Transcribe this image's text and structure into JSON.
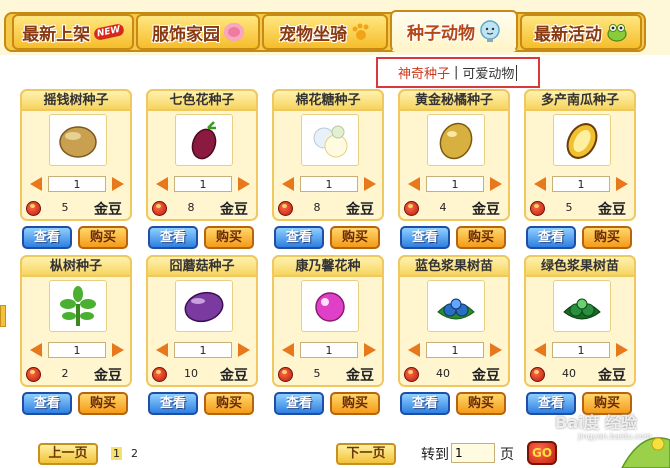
{
  "tabs": [
    {
      "label": "最新上架",
      "badge": "NEW",
      "icon": "new-badge-icon"
    },
    {
      "label": "服饰家园",
      "icon": "flower-icon"
    },
    {
      "label": "宠物坐骑",
      "icon": "paw-icon"
    },
    {
      "label": "种子动物",
      "icon": "lightbulb-icon",
      "active": true
    },
    {
      "label": "最新活动",
      "icon": "frog-icon"
    }
  ],
  "subcategory": {
    "items": [
      {
        "label": "神奇种子",
        "active": true
      },
      {
        "label": "可爱动物",
        "active": false
      }
    ],
    "separator": "|"
  },
  "items": [
    {
      "name": "摇钱树种子",
      "qty": "1",
      "price": "5",
      "currency": "金豆",
      "icon": "money-tree-seed-icon",
      "color": "#c8a050"
    },
    {
      "name": "七色花种子",
      "qty": "1",
      "price": "8",
      "currency": "金豆",
      "icon": "rainbow-flower-seed-icon",
      "color": "#8a1a40"
    },
    {
      "name": "棉花糖种子",
      "qty": "1",
      "price": "8",
      "currency": "金豆",
      "icon": "cotton-candy-seed-icon",
      "color": "#e8f0f8"
    },
    {
      "name": "黄金秘橘种子",
      "qty": "1",
      "price": "4",
      "currency": "金豆",
      "icon": "golden-orange-seed-icon",
      "color": "#d8b040"
    },
    {
      "name": "多产南瓜种子",
      "qty": "1",
      "price": "5",
      "currency": "金豆",
      "icon": "pumpkin-seed-icon",
      "color": "#f0c030"
    },
    {
      "name": "枞树种子",
      "qty": "1",
      "price": "2",
      "currency": "金豆",
      "icon": "fir-tree-seed-icon",
      "color": "#4ab030"
    },
    {
      "name": "囧蘑菇种子",
      "qty": "1",
      "price": "10",
      "currency": "金豆",
      "icon": "mushroom-seed-icon",
      "color": "#7a3aa0"
    },
    {
      "name": "康乃馨花种",
      "qty": "1",
      "price": "5",
      "currency": "金豆",
      "icon": "carnation-seed-icon",
      "color": "#e040c8"
    },
    {
      "name": "蓝色浆果树苗",
      "qty": "1",
      "price": "40",
      "currency": "金豆",
      "icon": "blue-berry-sapling-icon",
      "color": "#2a70c0"
    },
    {
      "name": "绿色浆果树苗",
      "qty": "1",
      "price": "40",
      "currency": "金豆",
      "icon": "green-berry-sapling-icon",
      "color": "#2a9040"
    }
  ],
  "buttons": {
    "view": "查看",
    "buy": "购买"
  },
  "pager": {
    "prev": "上一页",
    "next": "下一页",
    "pages": [
      "1",
      "2"
    ],
    "current": "1",
    "goto_label": "转到",
    "goto_value": "1",
    "page_label": "页",
    "go": "GO"
  },
  "watermark": {
    "text": "Bai度 经验",
    "sub": "jingyan.baidu.com"
  }
}
